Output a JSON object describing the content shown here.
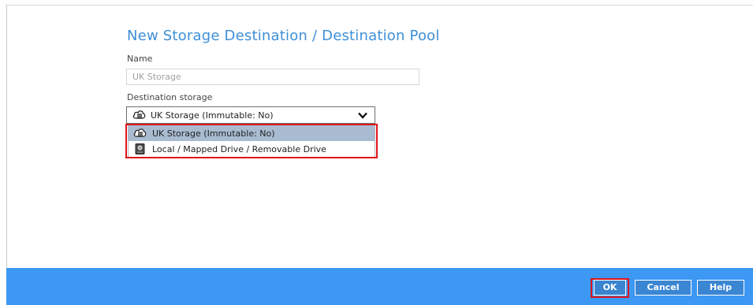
{
  "dialog": {
    "title": "New Storage Destination / Destination Pool",
    "name_label": "Name",
    "name_value": "UK Storage",
    "destination_label": "Destination storage",
    "selected_destination": "UK Storage (Immutable: No)",
    "options": [
      {
        "label": "UK Storage (Immutable: No)",
        "icon": "cloud-storage-icon",
        "selected": true
      },
      {
        "label": "Local / Mapped Drive / Removable Drive",
        "icon": "hard-drive-icon",
        "selected": false
      }
    ]
  },
  "footer": {
    "ok_label": "OK",
    "cancel_label": "Cancel",
    "help_label": "Help"
  },
  "colors": {
    "title": "#3e8fd8",
    "footer_bg": "#3c98f2",
    "highlight": "#e0151b",
    "selected_option_bg": "#a9bbd1"
  }
}
